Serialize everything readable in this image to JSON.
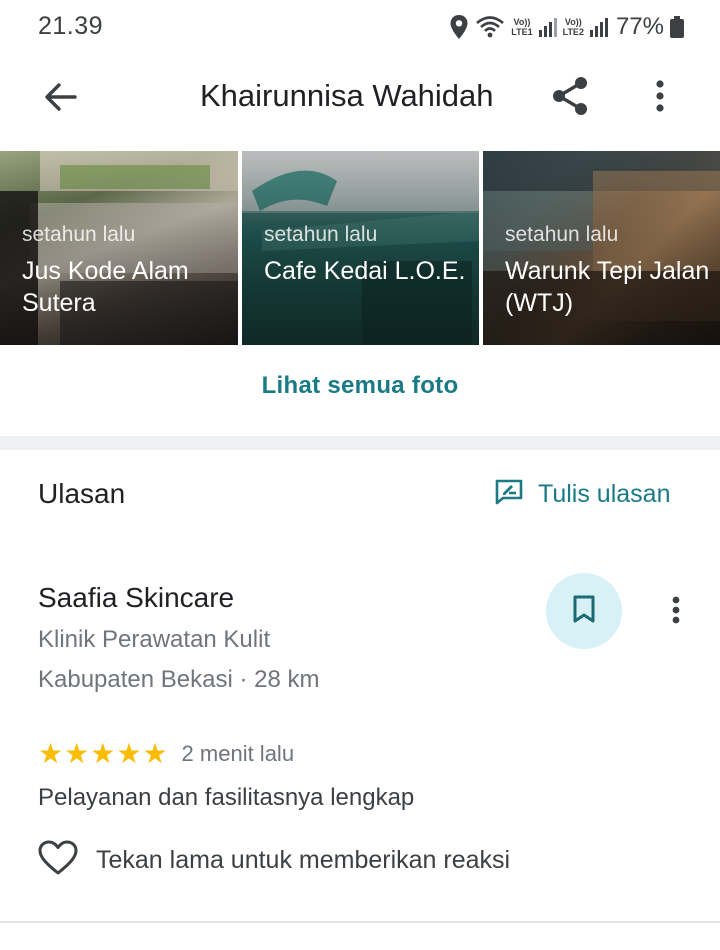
{
  "status_bar": {
    "time": "21.39",
    "sim1_label_top": "Vo))",
    "sim1_label_bottom": "LTE1",
    "sim2_label_top": "Vo))",
    "sim2_label_bottom": "LTE2",
    "battery": "77%",
    "icons": [
      "location-icon",
      "wifi-icon",
      "signal-icon",
      "battery-icon"
    ]
  },
  "app_bar": {
    "title": "Khairunnisa Wahidah",
    "icons": [
      "back-arrow-icon",
      "share-icon",
      "more-vert-icon"
    ]
  },
  "photos": [
    {
      "time": "setahun lalu",
      "name": "Jus Kode Alam Sutera"
    },
    {
      "time": "setahun lalu",
      "name": "Cafe Kedai L.O.E."
    },
    {
      "time": "setahun lalu",
      "name": "Warunk Tepi Jalan (WTJ)"
    }
  ],
  "see_all_label": "Lihat semua foto",
  "reviews": {
    "title": "Ulasan",
    "write_label": "Tulis ulasan",
    "item": {
      "place_name": "Saafia Skincare",
      "category": "Klinik Perawatan Kulit",
      "location": "Kabupaten Bekasi · 28 km",
      "rating": 5,
      "max_rating": 5,
      "time": "2 menit lalu",
      "text": "Pelayanan dan fasilitasnya lengkap",
      "react_label": "Tekan lama untuk memberikan reaksi"
    }
  },
  "colors": {
    "accent": "#1a7a86",
    "star": "#fbbc04",
    "save_bg": "#d8f1f6",
    "secondary_text": "#70757a"
  }
}
